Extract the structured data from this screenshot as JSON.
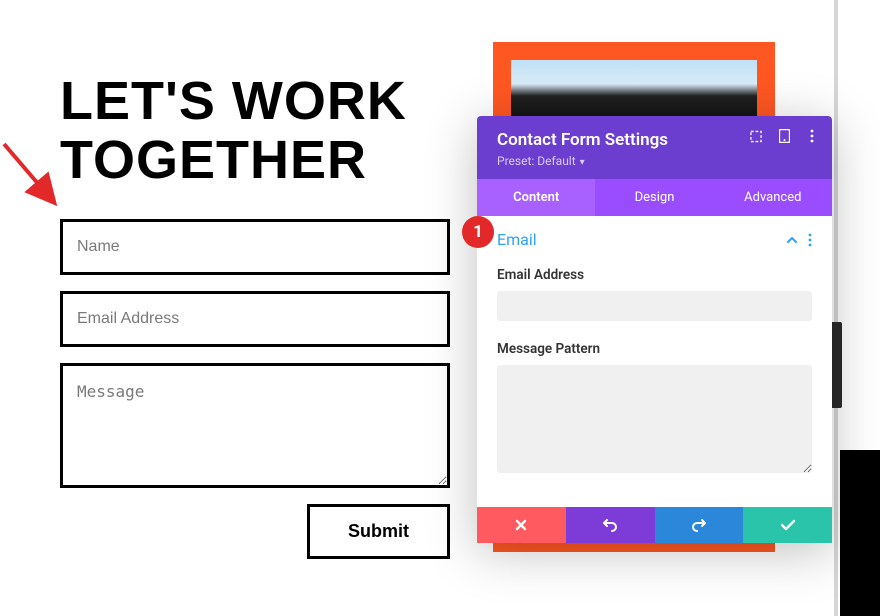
{
  "form": {
    "heading": "LET'S WORK TOGETHER",
    "name_placeholder": "Name",
    "email_placeholder": "Email Address",
    "message_placeholder": "Message",
    "submit_label": "Submit"
  },
  "panel": {
    "title": "Contact Form Settings",
    "preset_label": "Preset: Default",
    "tabs": {
      "content": "Content",
      "design": "Design",
      "advanced": "Advanced"
    },
    "section_title": "Email",
    "fields": {
      "email_label": "Email Address",
      "email_value": "",
      "pattern_label": "Message Pattern",
      "pattern_value": ""
    }
  },
  "annotations": {
    "badge_1": "1"
  }
}
